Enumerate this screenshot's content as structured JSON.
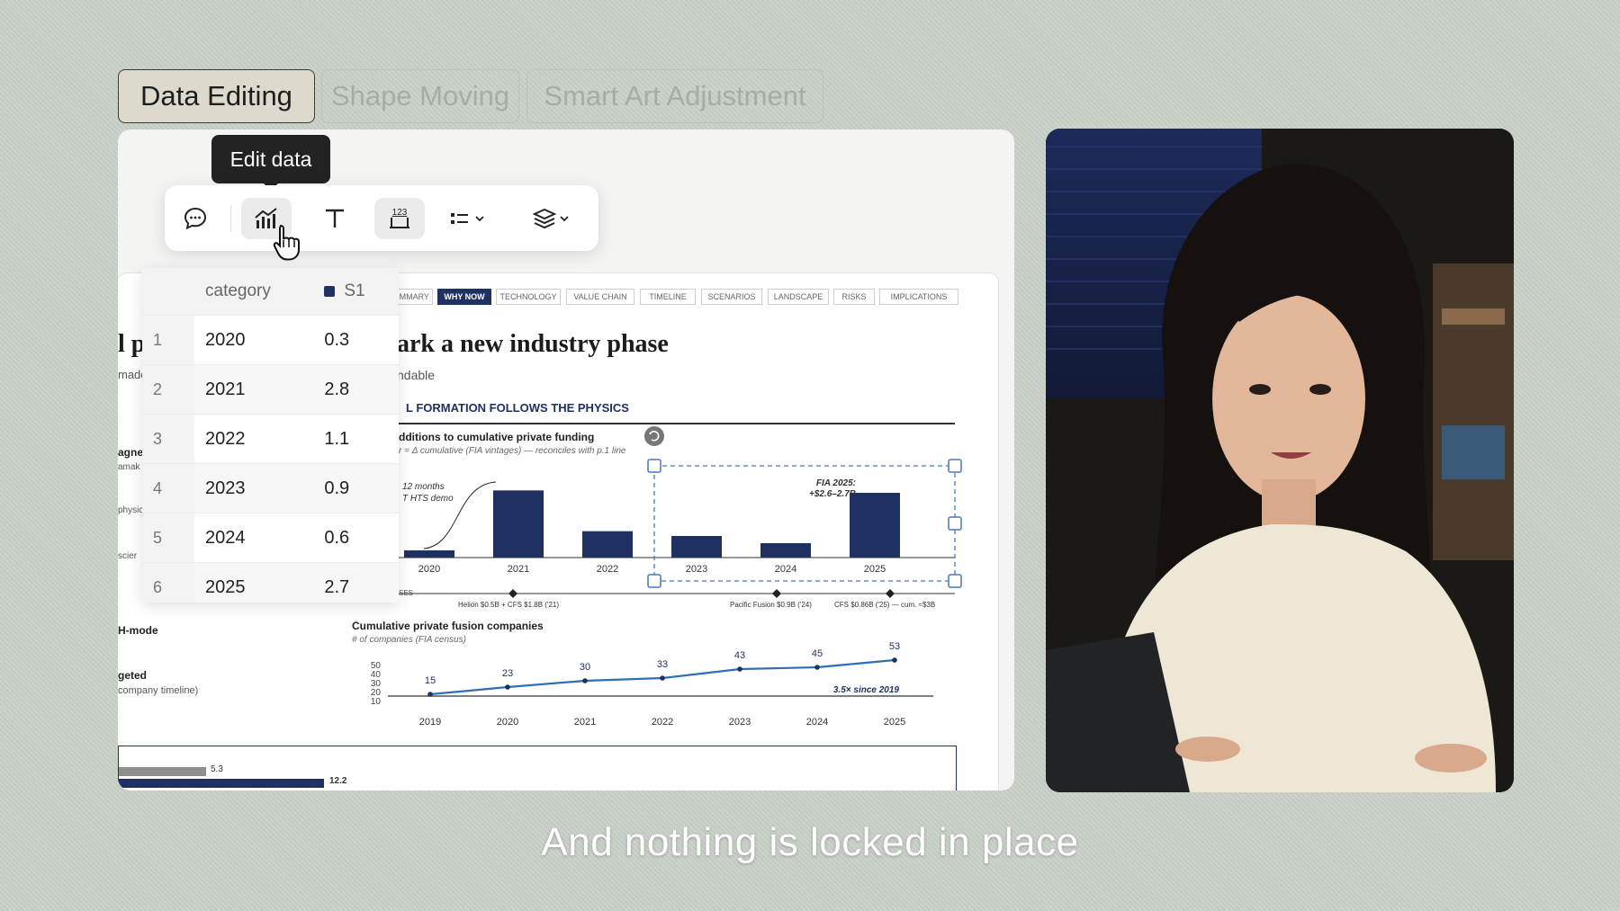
{
  "modes": [
    "Data Editing",
    "Shape Moving",
    "Smart Art Adjustment"
  ],
  "tooltip": "Edit data",
  "toolbar_icons": [
    "comment-icon",
    "chart-edit-icon",
    "text-icon",
    "number-format-icon",
    "list-style-icon",
    "layers-icon"
  ],
  "table": {
    "headers": [
      "category",
      "S1"
    ],
    "series_color": "#1f3161",
    "rows": [
      {
        "index": "1",
        "category": "2020",
        "value": "0.3"
      },
      {
        "index": "2",
        "category": "2021",
        "value": "2.8"
      },
      {
        "index": "3",
        "category": "2022",
        "value": "1.1"
      },
      {
        "index": "4",
        "category": "2023",
        "value": "0.9"
      },
      {
        "index": "5",
        "category": "2024",
        "value": "0.6"
      },
      {
        "index": "6",
        "category": "2025",
        "value": "2.7"
      }
    ]
  },
  "slide": {
    "nav": [
      "IMMARY",
      "WHY NOW",
      "TECHNOLOGY",
      "VALUE CHAIN",
      "TIMELINE",
      "SCENARIOS",
      "LANDSCAPE",
      "RISKS",
      "IMPLICATIONS"
    ],
    "active_nav": "WHY NOW",
    "title": "ark a new industry phase",
    "left_title_fragment": "l p",
    "subtitle": "ndable",
    "left_fragment": "made",
    "section_header": "L FORMATION FOLLOWS THE PHYSICS",
    "left_labels": {
      "l1": "agne",
      "l2": "amak",
      "l3": "physic",
      "l4": "scier",
      "h_mode": "H-mode",
      "geted": "geted",
      "timeline": "company timeline)"
    },
    "bottom_bars": {
      "a_label": "5.3",
      "b_label": "12.2"
    }
  },
  "chart_data": [
    {
      "type": "bar",
      "title": "dditions to cumulative private funding",
      "subtitle": "r = Δ cumulative (FIA vintages) — reconciles with p.1 line",
      "categories": [
        "2020",
        "2021",
        "2022",
        "2023",
        "2024",
        "2025"
      ],
      "values": [
        0.3,
        2.8,
        1.1,
        0.9,
        0.6,
        2.7
      ],
      "ylim": [
        0,
        3.0
      ],
      "color": "#1f3161",
      "annotations": {
        "left": "12 months\nT HTS demo",
        "fia": "FIA 2025:\n+$2.6–2.7B",
        "ses": "SES",
        "helion": "Helion $0.5B + CFS $1.8B ('21)",
        "pacific": "Pacific Fusion $0.9B ('24)",
        "cfs": "CFS $0.86B ('25) — cum. ≈$3B"
      }
    },
    {
      "type": "line",
      "title": "Cumulative private fusion companies",
      "subtitle": "# of companies (FIA census)",
      "x": [
        "2019",
        "2020",
        "2021",
        "2022",
        "2023",
        "2024",
        "2025"
      ],
      "values": [
        15,
        23,
        30,
        33,
        43,
        45,
        53
      ],
      "value_labels": [
        "15",
        "23",
        "30",
        "33",
        "43",
        "45",
        "53"
      ],
      "yticks": [
        "50",
        "40",
        "30",
        "20",
        "10"
      ],
      "ylim": [
        0,
        55
      ],
      "color": "#2f6fb5",
      "annotation": "3.5× since 2019"
    }
  ],
  "caption": "And nothing is locked in place"
}
